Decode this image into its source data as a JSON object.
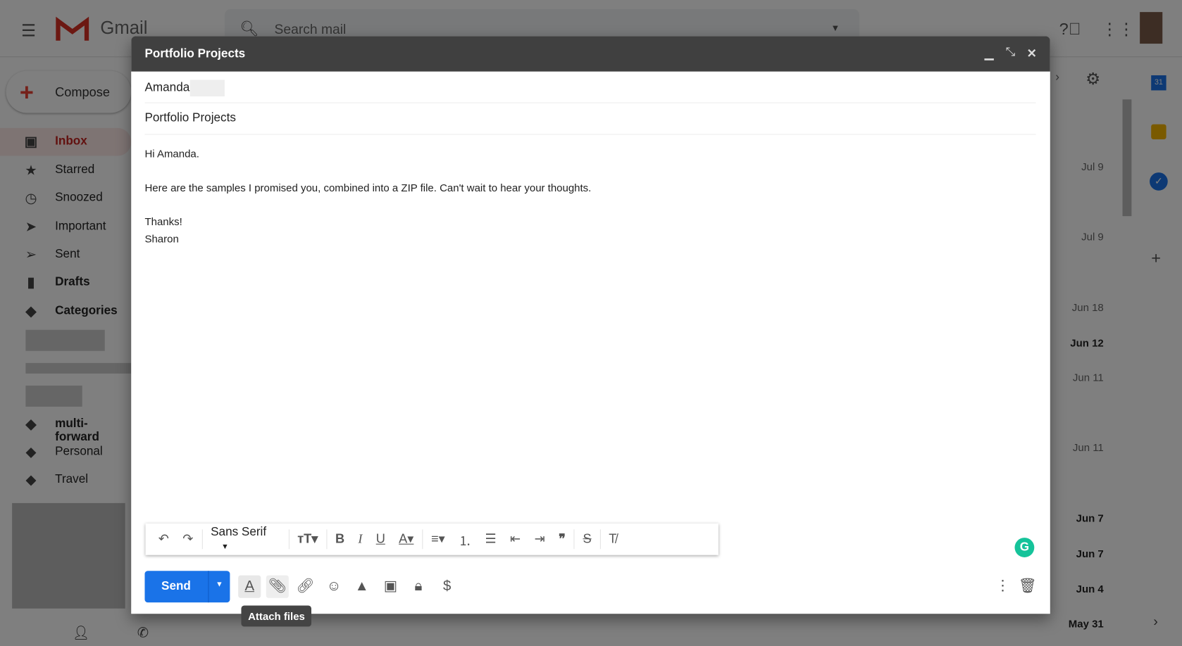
{
  "app": {
    "name": "Gmail",
    "search_placeholder": "Search mail",
    "icons": [
      "menu-icon",
      "search-icon",
      "help-icon",
      "apps-icon",
      "settings-icon"
    ]
  },
  "sidebar": {
    "compose": "Compose",
    "items": [
      {
        "label": "Inbox",
        "icon": "inbox-icon"
      },
      {
        "label": "Starred",
        "icon": "star-icon"
      },
      {
        "label": "Snoozed",
        "icon": "clock-icon"
      },
      {
        "label": "Important",
        "icon": "important-icon"
      },
      {
        "label": "Sent",
        "icon": "send-icon"
      },
      {
        "label": "Drafts",
        "icon": "draft-icon"
      },
      {
        "label": "Categories",
        "icon": "label-icon"
      },
      {
        "label": "multi-forward",
        "icon": "label-icon"
      },
      {
        "label": "Personal",
        "icon": "label-icon"
      },
      {
        "label": "Travel",
        "icon": "label-icon"
      }
    ]
  },
  "mail_dates": [
    {
      "d": "Jul 9",
      "bold": false
    },
    {
      "d": "Jul 9",
      "bold": false
    },
    {
      "d": "Jun 18",
      "bold": false
    },
    {
      "d": "Jun 12",
      "bold": true
    },
    {
      "d": "Jun 11",
      "bold": false
    },
    {
      "d": "Jun 11",
      "bold": false
    },
    {
      "d": "Jun 7",
      "bold": true
    },
    {
      "d": "Jun 7",
      "bold": true
    },
    {
      "d": "Jun 4",
      "bold": true
    },
    {
      "d": "May 31",
      "bold": true
    }
  ],
  "compose": {
    "title": "Portfolio Projects",
    "to": "Amanda",
    "subject": "Portfolio Projects",
    "body": [
      "Hi Amanda.",
      "",
      "Here are the samples I promised you, combined into a ZIP file. Can't wait to hear your thoughts.",
      "",
      "Thanks!",
      "Sharon"
    ],
    "font": "Sans Serif",
    "send": "Send",
    "tooltip": "Attach files",
    "colors": {
      "send": "#1a73e8",
      "titlebar": "#404040",
      "grammarly": "#15c39a"
    }
  }
}
